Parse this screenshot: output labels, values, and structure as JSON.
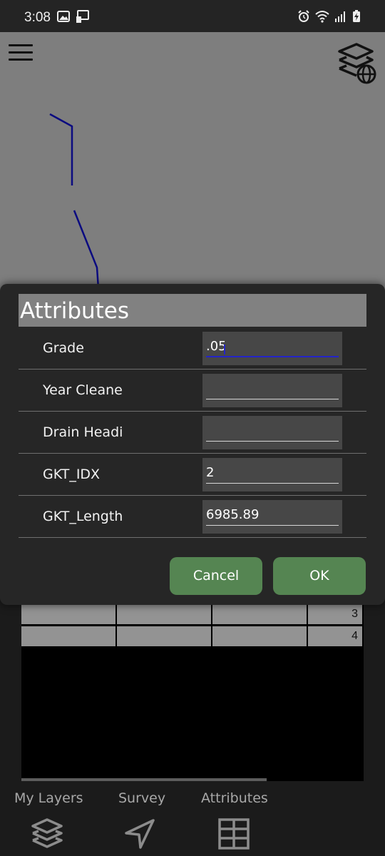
{
  "status_bar": {
    "time": "3:08",
    "left_icons": [
      "image-icon",
      "cast-icon"
    ],
    "right_icons": [
      "alarm-icon",
      "wifi-icon",
      "signal-icon",
      "battery-charging-icon"
    ]
  },
  "map": {
    "background": "#7e7e7e",
    "line_color": "#0b0b80",
    "icons": [
      "menu-icon",
      "layers-globe-icon"
    ]
  },
  "dialog": {
    "title": "Attributes",
    "fields": [
      {
        "label": "Grade",
        "value": ".05"
      },
      {
        "label": "Year Cleane",
        "value": ""
      },
      {
        "label": "Drain Headi",
        "value": ""
      },
      {
        "label": "GKT_IDX",
        "value": "2"
      },
      {
        "label": "GKT_Length",
        "value": "6985.89"
      }
    ],
    "cancel_label": "Cancel",
    "ok_label": "OK",
    "button_color": "#558552"
  },
  "table": {
    "rows": [
      {
        "cells": [
          "",
          "",
          ""
        ],
        "id": "3"
      },
      {
        "cells": [
          "",
          "",
          ""
        ],
        "id": "4"
      }
    ]
  },
  "bottom_nav": {
    "items": [
      {
        "label": "My Layers",
        "icon": "layers-icon"
      },
      {
        "label": "Survey",
        "icon": "navigation-arrow-icon"
      },
      {
        "label": "Attributes",
        "icon": "grid-table-icon"
      }
    ]
  }
}
